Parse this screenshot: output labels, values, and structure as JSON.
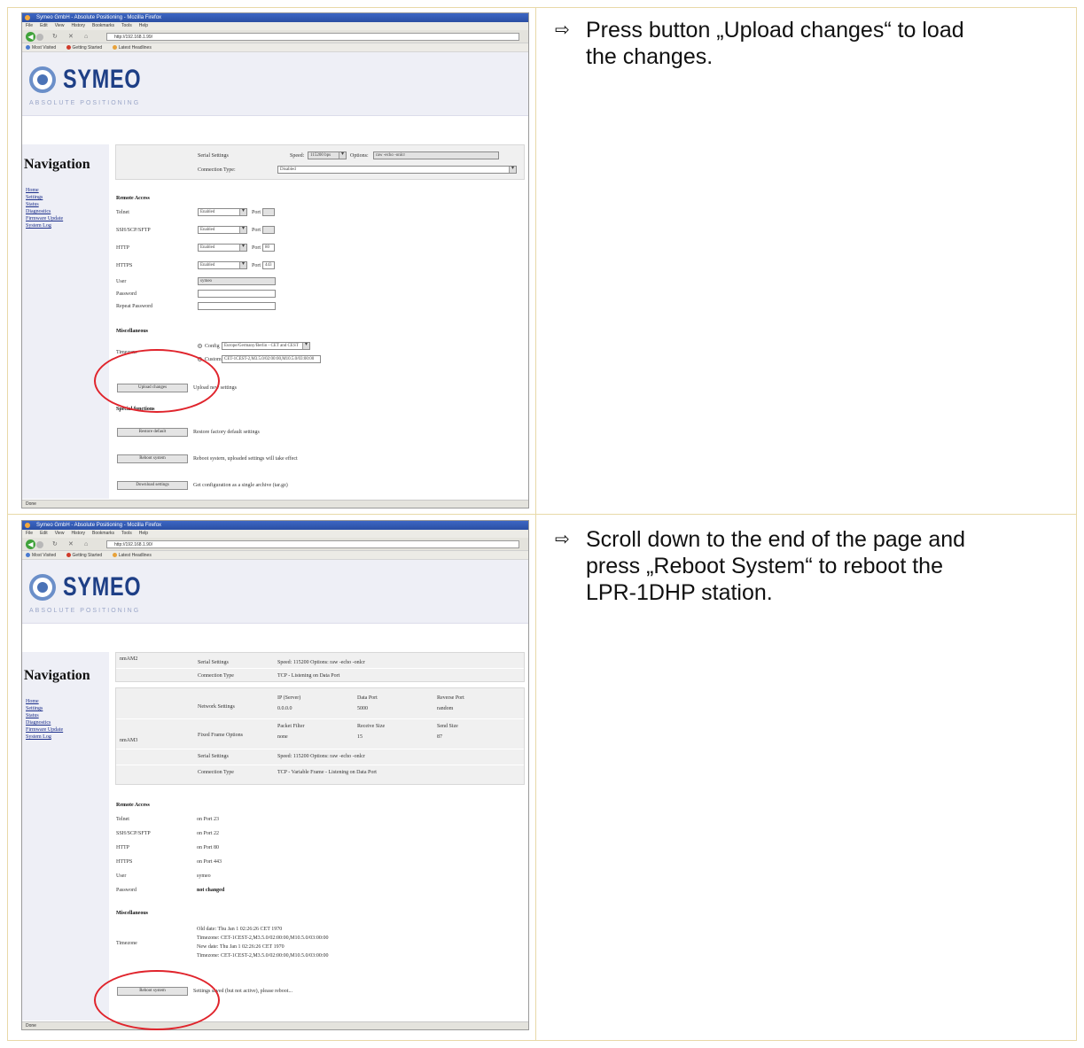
{
  "instructions": [
    {
      "arrow": "⇨",
      "line1": "Press  button „Upload changes“ to load",
      "line2": "the changes."
    },
    {
      "arrow": "⇨",
      "line1": "Scroll down to the end of the page and",
      "line2": "press „Reboot System“ to reboot the",
      "line3": "LPR-1DHP station."
    }
  ],
  "browser": {
    "title": "Symeo GmbH - Absolute Positioning - Mozilla Firefox",
    "menu": [
      "File",
      "Edit",
      "View",
      "History",
      "Bookmarks",
      "Tools",
      "Help"
    ],
    "url1": "http://192.168.1.99/",
    "url2": "http://192.168.1.90/",
    "bookmarks": [
      "Most Visited",
      "Getting Started",
      "Latest Headlines"
    ],
    "logo": "SYMEO",
    "tagline": "ABSOLUTE POSITIONING",
    "nav_title": "Navigation",
    "nav_links": [
      "Home",
      "Settings",
      "Status",
      "Diagnostics",
      "Firmware Update",
      "System Log"
    ],
    "status": "Done"
  },
  "shot1": {
    "serial_label": "Serial Settings",
    "speed_label": "Speed:",
    "speed_value": "115200 bps",
    "options_label": "Options:",
    "options_value": "raw -echo -onlcr",
    "conn_label": "Connection Type:",
    "conn_value": "Disabled",
    "remote_title": "Remote Access",
    "rows": [
      {
        "label": "Telnet",
        "value": "Enabled",
        "port": ""
      },
      {
        "label": "SSH/SCP/SFTP",
        "value": "Enabled",
        "port": ""
      },
      {
        "label": "HTTP",
        "value": "Enabled",
        "port": "80"
      },
      {
        "label": "HTTPS",
        "value": "Enabled",
        "port": "443"
      }
    ],
    "port_label": "Port",
    "user_label": "User",
    "user_value": "symeo",
    "password_label": "Password",
    "repeat_label": "Repeat Password",
    "misc_title": "Miscellaneous",
    "tz_label": "Timezone",
    "config_label": "Config",
    "config_value": "Europe/Germany/Berlin - CET and CEST",
    "custom_label": "Custom",
    "custom_value": "CET-1CEST-2,M3.5.0/02:00:00,M10.5.0/03:00:00",
    "upload_btn": "Upload changes",
    "upload_desc": "Upload new settings",
    "special_title": "Special functions",
    "restore_btn": "Restore default",
    "restore_desc": "Restore factory default settings",
    "reboot_btn": "Reboot system",
    "reboot_desc": "Reboot system, uploaded settings will take effect",
    "download_btn": "Download settings",
    "download_desc": "Get configuration as a single archive (tar.gz)"
  },
  "shot2": {
    "nmea1": "nmAM2",
    "serial_label": "Serial Settings",
    "serial_value": "Speed: 115200 Options: raw -echo -onlcr",
    "conn_label": "Connection Type",
    "conn_value": "TCP - Listening on Data Port",
    "nmea2": "nmAM3",
    "net_label": "Network Settings",
    "ip_head": "IP (Server)",
    "ip_value": "0.0.0.0",
    "dport_head": "Data Port",
    "dport_value": "5000",
    "rport_head": "Reverse Port",
    "rport_value": "random",
    "fixed_label": "Fixed Frame Options",
    "filter_head": "Packet Filter",
    "filter_value": "none",
    "recv_head": "Receive Size",
    "recv_value": "15",
    "send_head": "Send Size",
    "send_value": "87",
    "serial2_label": "Serial Settings",
    "serial2_value": "Speed: 115200 Options: raw -echo -onlcr",
    "conn2_label": "Connection Type",
    "conn2_value": "TCP - Variable Frame - Listening on Data Port",
    "remote_title": "Remote Access",
    "rows": [
      {
        "label": "Telnet",
        "value": "on Port 23"
      },
      {
        "label": "SSH/SCP/SFTP",
        "value": "on Port 22"
      },
      {
        "label": "HTTP",
        "value": "on Port 80"
      },
      {
        "label": "HTTPS",
        "value": "on Port 443"
      },
      {
        "label": "User",
        "value": "symeo"
      },
      {
        "label": "Password",
        "value": "not changed"
      }
    ],
    "misc_title": "Miscellaneous",
    "tz_label": "Timezone",
    "tz_lines": [
      "Old date:  Thu Jan 1 02:26:26 CET 1970",
      "Timezone:  CET-1CEST-2,M3.5.0/02:00:00,M10.5.0/03:00:00",
      "New date:  Thu Jan 1 02:26:26 CET 1970",
      "Timezone:  CET-1CEST-2,M3.5.0/02:00:00,M10.5.0/03:00:00"
    ],
    "reboot_btn": "Reboot system",
    "reboot_desc": "Settings saved (but not active), please reboot..."
  }
}
